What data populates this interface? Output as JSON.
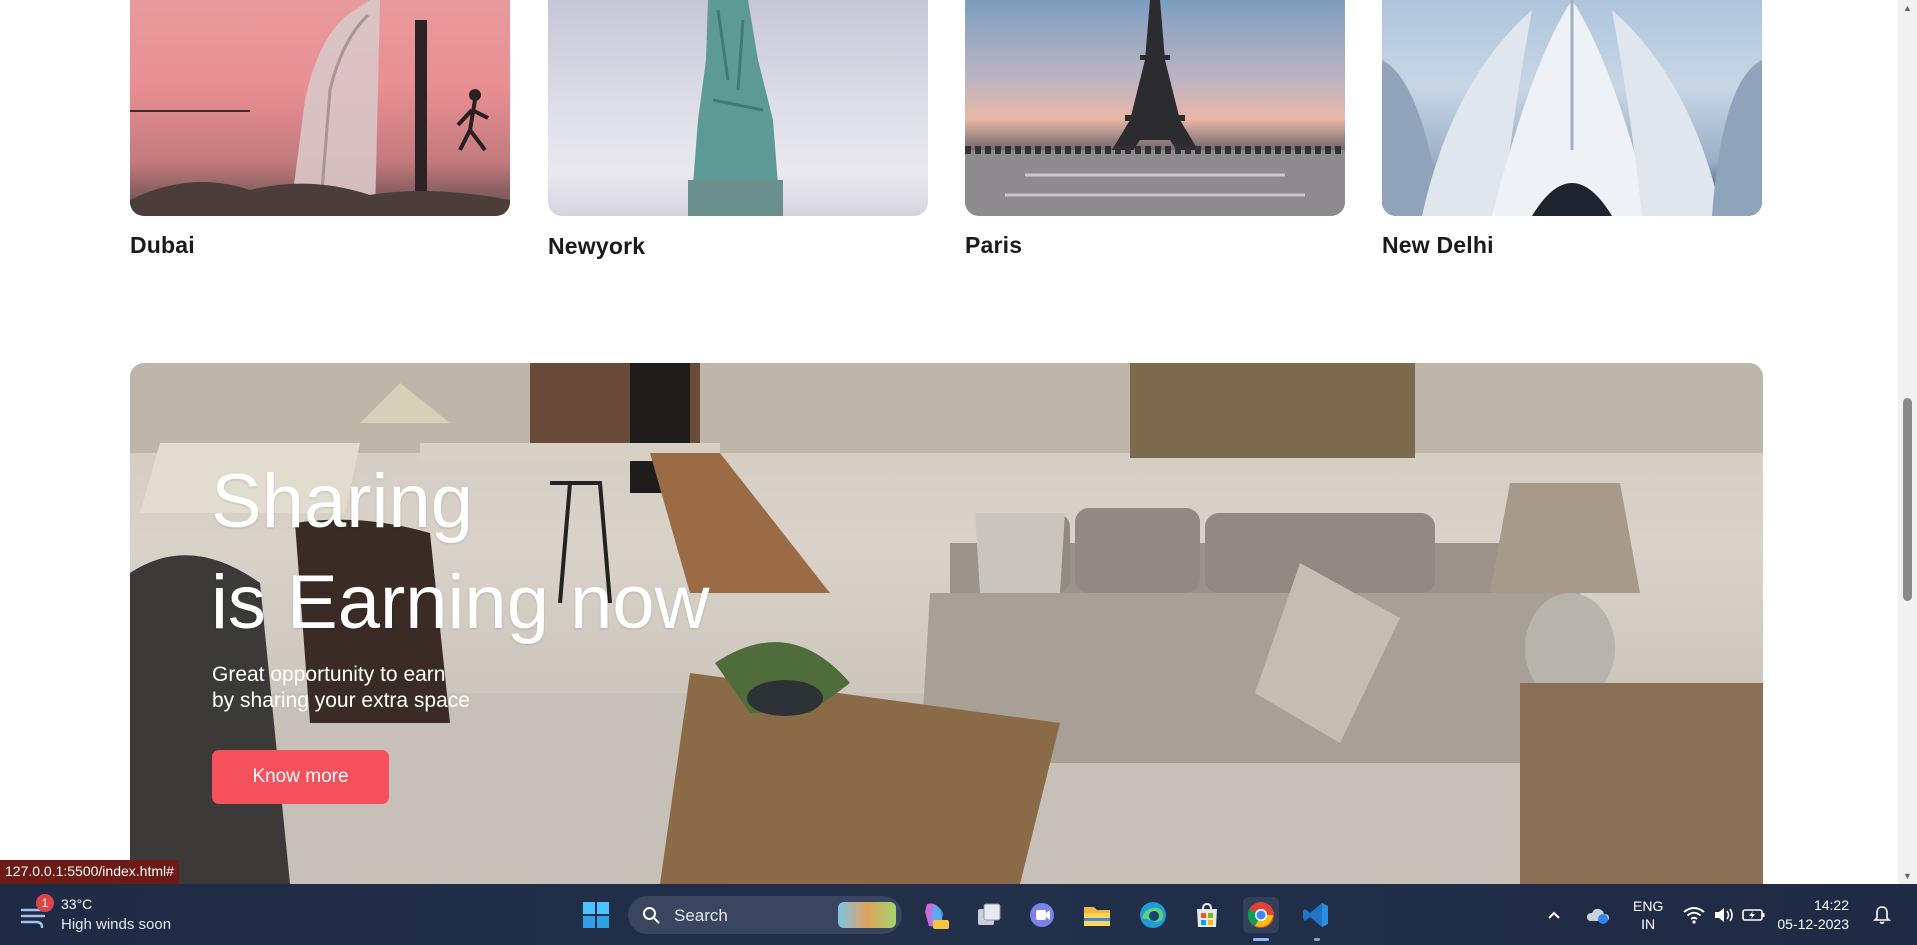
{
  "destinations": [
    {
      "name": "Dubai"
    },
    {
      "name": "Newyork"
    },
    {
      "name": "Paris"
    },
    {
      "name": "New Delhi"
    }
  ],
  "hero": {
    "title_line1": "Sharing",
    "title_line2": "is Earning now",
    "subtitle_line1": "Great opportunity to earn",
    "subtitle_line2": "by sharing your extra space",
    "button_label": "Know more",
    "button_color": "#f4515c"
  },
  "status_bar": {
    "url": "127.0.0.1:5500/index.html#"
  },
  "taskbar": {
    "weather": {
      "badge": "1",
      "temperature": "33°C",
      "description": "High winds soon"
    },
    "search_label": "Search",
    "apps": [
      "windows-start",
      "search",
      "copilot-pre",
      "task-view",
      "teams-meet",
      "file-explorer",
      "edge",
      "microsoft-store",
      "chrome",
      "vscode"
    ],
    "language_line1": "ENG",
    "language_line2": "IN",
    "time": "14:22",
    "date": "05-12-2023"
  }
}
